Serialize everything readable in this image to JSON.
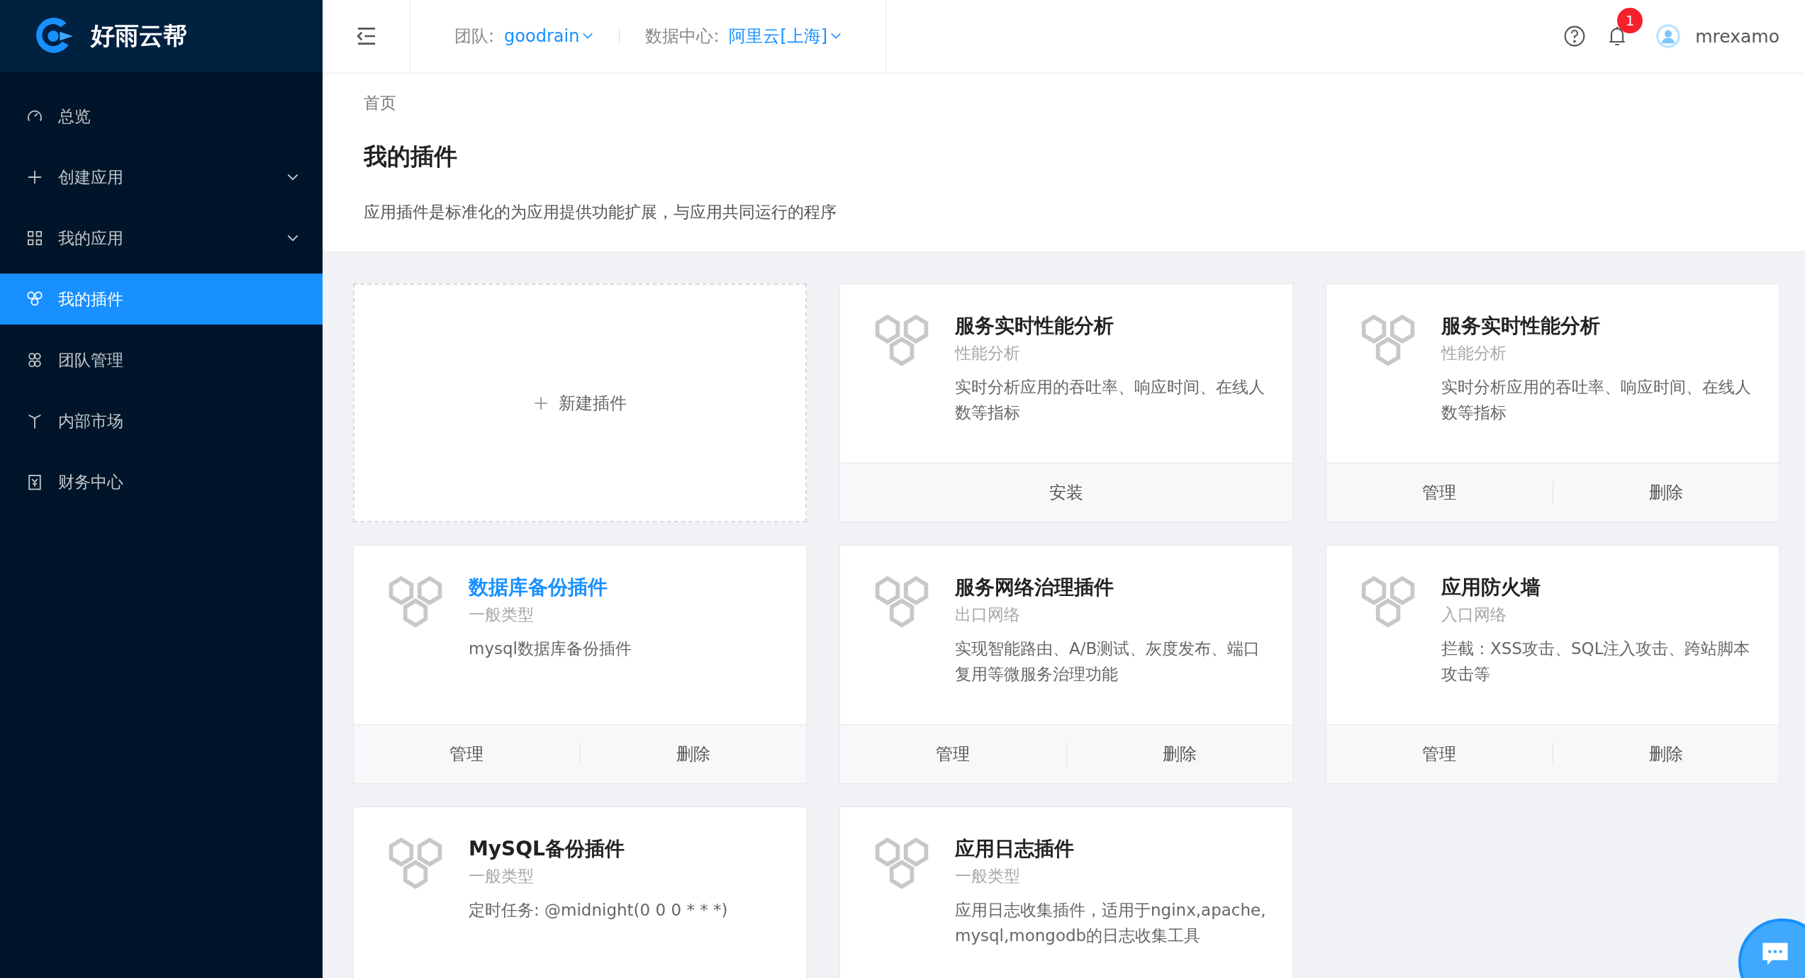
{
  "sidebar": {
    "brand": "好雨云帮",
    "items": [
      {
        "label": "总览",
        "expandable": false,
        "selected": false
      },
      {
        "label": "创建应用",
        "expandable": true,
        "selected": false
      },
      {
        "label": "我的应用",
        "expandable": true,
        "selected": false
      },
      {
        "label": "我的插件",
        "expandable": false,
        "selected": true
      },
      {
        "label": "团队管理",
        "expandable": false,
        "selected": false
      },
      {
        "label": "内部市场",
        "expandable": false,
        "selected": false
      },
      {
        "label": "财务中心",
        "expandable": false,
        "selected": false
      }
    ]
  },
  "header": {
    "team_label": "团队:",
    "team": "goodrain",
    "datacenter_label": "数据中心:",
    "datacenter": "阿里云[上海]",
    "notification_count": "1",
    "user": "mrexamo"
  },
  "page": {
    "breadcrumb": "首页",
    "title": "我的插件",
    "description": "应用插件是标准化的为应用提供功能扩展，与应用共同运行的程序"
  },
  "cards": [
    {
      "kind": "new",
      "label": "新建插件"
    },
    {
      "kind": "plugin",
      "title": "服务实时性能分析",
      "category": "性能分析",
      "description": "实时分析应用的吞吐率、响应时间、在线人数等指标",
      "hovered": false,
      "actions": [
        "安装"
      ]
    },
    {
      "kind": "plugin",
      "title": "服务实时性能分析",
      "category": "性能分析",
      "description": "实时分析应用的吞吐率、响应时间、在线人数等指标",
      "hovered": false,
      "actions": [
        "管理",
        "删除"
      ]
    },
    {
      "kind": "plugin",
      "title": "数据库备份插件",
      "category": "一般类型",
      "description": "mysql数据库备份插件",
      "hovered": true,
      "actions": [
        "管理",
        "删除"
      ]
    },
    {
      "kind": "plugin",
      "title": "服务网络治理插件",
      "category": "出口网络",
      "description": "实现智能路由、A/B测试、灰度发布、端口复用等微服务治理功能",
      "hovered": false,
      "actions": [
        "管理",
        "删除"
      ]
    },
    {
      "kind": "plugin",
      "title": "应用防火墙",
      "category": "入口网络",
      "description": "拦截：XSS攻击、SQL注入攻击、跨站脚本攻击等",
      "hovered": false,
      "actions": [
        "管理",
        "删除"
      ]
    },
    {
      "kind": "plugin",
      "title": "MySQL备份插件",
      "category": "一般类型",
      "description": "定时任务: @midnight(0 0 0 * * *)",
      "hovered": false
    },
    {
      "kind": "plugin",
      "title": "应用日志插件",
      "category": "一般类型",
      "description": "应用日志收集插件，适用于nginx,apache,mysql,mongodb的日志收集工具",
      "hovered": false
    }
  ]
}
